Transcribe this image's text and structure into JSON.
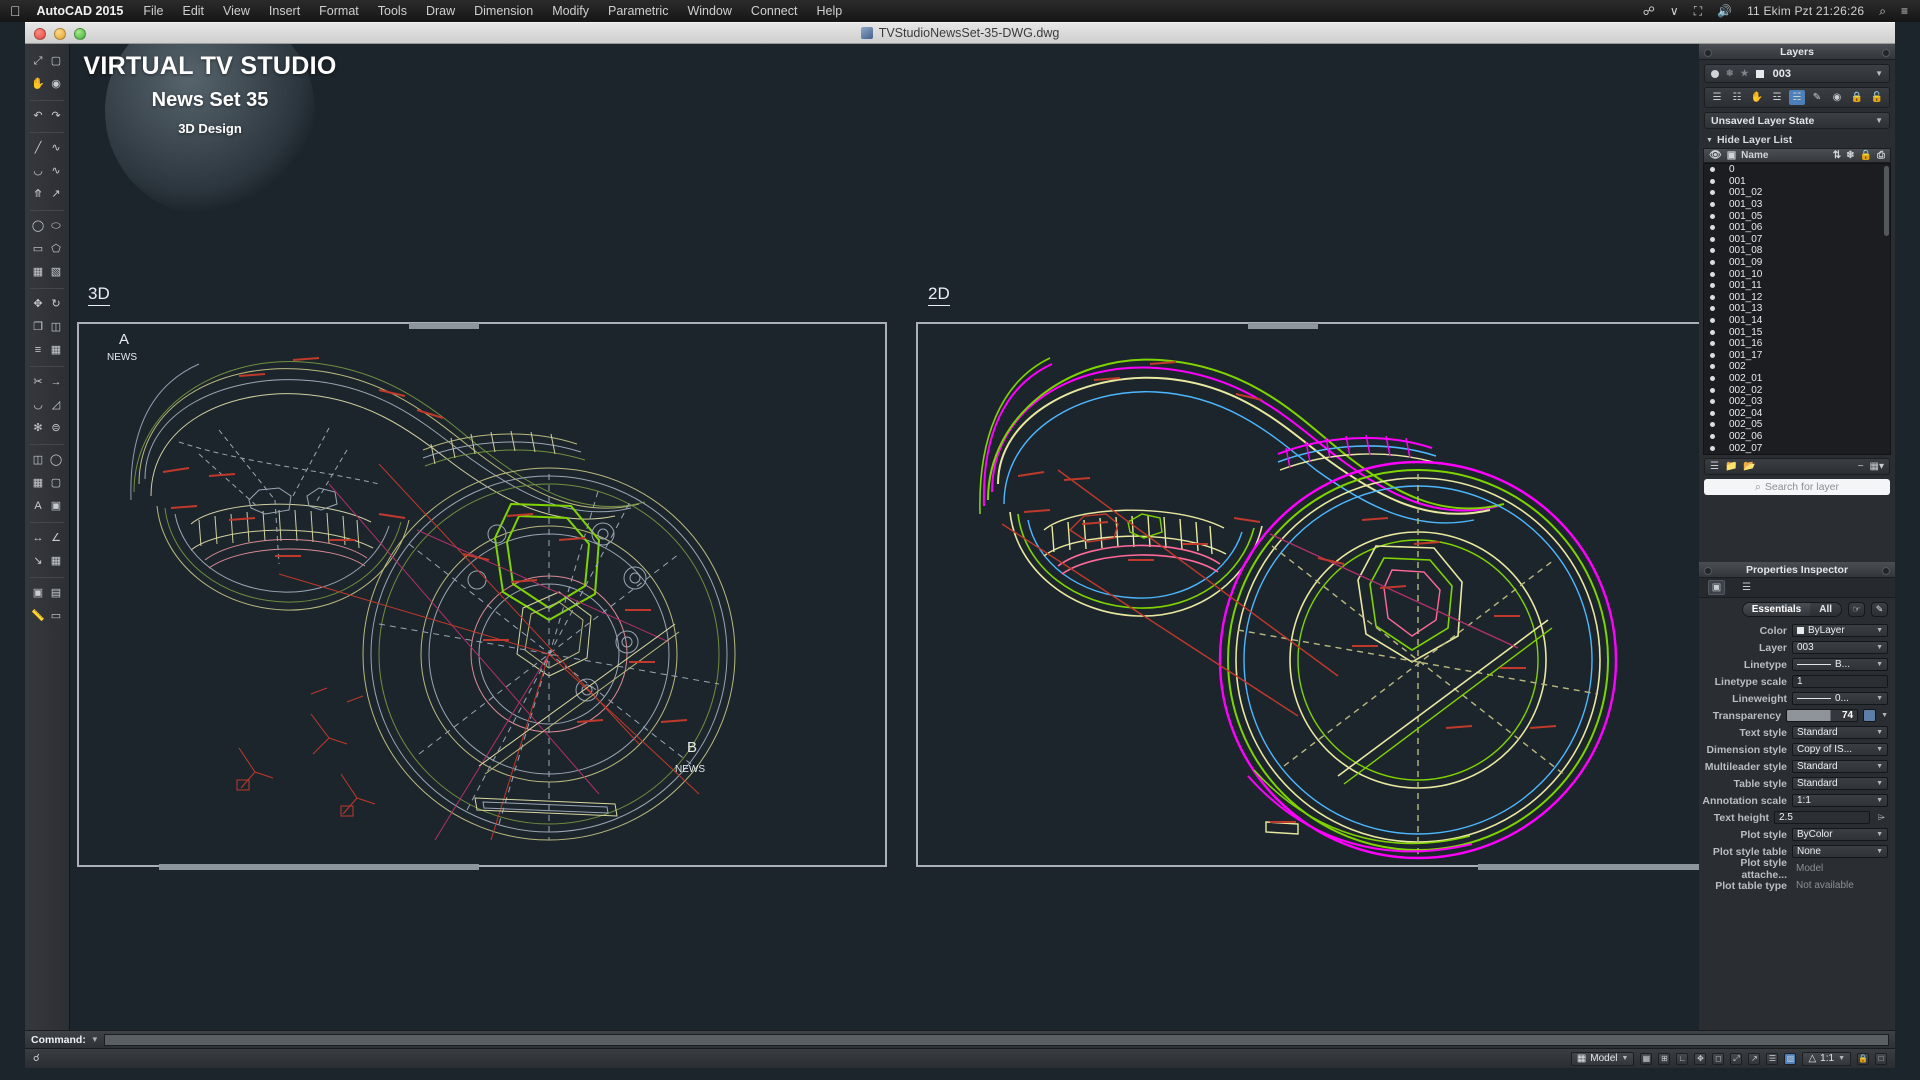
{
  "os_menu": {
    "apple_icon": "apple-icon",
    "app_name": "AutoCAD 2015",
    "items": [
      "File",
      "Edit",
      "View",
      "Insert",
      "Format",
      "Tools",
      "Draw",
      "Dimension",
      "Modify",
      "Parametric",
      "Window",
      "Connect",
      "Help"
    ],
    "status_icons": [
      "bluetooth-icon",
      "chevron-icon",
      "airplay-icon",
      "volume-icon"
    ],
    "clock": "11 Ekim Pzt 21:26:26",
    "search_icon": "search-icon",
    "notifications_icon": "list-icon"
  },
  "window": {
    "title": "TVStudioNewsSet-35-DWG.dwg",
    "file_icon": "dwg-file-icon",
    "close_icon": "close-icon",
    "minimize_icon": "minimize-icon",
    "zoom_icon": "zoom-icon"
  },
  "watermark": {
    "line1": "VIRTUAL TV STUDIO",
    "line2": "News Set 35",
    "line3": "3D Design"
  },
  "viewports": [
    {
      "label": "3D",
      "corner_top": "A",
      "corner_top_sub": "NEWS",
      "corner_bot": "B",
      "corner_bot_sub": "NEWS"
    },
    {
      "label": "2D"
    }
  ],
  "layers_panel": {
    "title": "Layers",
    "current_layer": "003",
    "state_selector": "Unsaved Layer State",
    "hide_list_label": "Hide Layer List",
    "column_name": "Name",
    "column_icons": [
      "visibility-icon",
      "filter-icon",
      "sort-icon",
      "freeze-icon",
      "lock-icon",
      "plot-icon"
    ],
    "toolbar_icons": [
      "new-layer-icon",
      "new-layer-vp-icon",
      "delete-layer-icon",
      "set-current-icon",
      "layer-properties-icon",
      "layer-walk-icon",
      "layer-isolate-icon",
      "layer-lock-icon",
      "layer-unlock-icon"
    ],
    "footer_icons": [
      "layer-states-icon",
      "new-group-filter-icon",
      "new-property-filter-icon"
    ],
    "footer_collapse": "minus-icon",
    "footer_view": "columns-icon",
    "search_placeholder": "Search for layer",
    "search_icon": "search-icon",
    "layers": [
      "0",
      "001",
      "001_02",
      "001_03",
      "001_05",
      "001_06",
      "001_07",
      "001_08",
      "001_09",
      "001_10",
      "001_11",
      "001_12",
      "001_13",
      "001_14",
      "001_15",
      "001_16",
      "001_17",
      "002",
      "002_01",
      "002_02",
      "002_03",
      "002_04",
      "002_05",
      "002_06",
      "002_07"
    ]
  },
  "properties_panel": {
    "title": "Properties Inspector",
    "tab_icons": [
      "object-properties-icon",
      "layers-stack-icon"
    ],
    "segments": [
      "Essentials",
      "All"
    ],
    "active_segment": "Essentials",
    "action_icons": [
      "quick-select-icon",
      "pickadd-icon"
    ],
    "rows": [
      {
        "label": "Color",
        "value": "ByLayer",
        "kind": "color"
      },
      {
        "label": "Layer",
        "value": "003",
        "kind": "select"
      },
      {
        "label": "Linetype",
        "value": "B...",
        "kind": "linetype"
      },
      {
        "label": "Linetype scale",
        "value": "1",
        "kind": "text"
      },
      {
        "label": "Lineweight",
        "value": "0...",
        "kind": "linetype"
      },
      {
        "label": "Transparency",
        "value": "74",
        "kind": "transparency"
      },
      {
        "label": "Text style",
        "value": "Standard",
        "kind": "select"
      },
      {
        "label": "Dimension style",
        "value": "Copy of IS...",
        "kind": "select"
      },
      {
        "label": "Multileader style",
        "value": "Standard",
        "kind": "select"
      },
      {
        "label": "Table style",
        "value": "Standard",
        "kind": "select"
      },
      {
        "label": "Annotation scale",
        "value": "1:1",
        "kind": "select"
      },
      {
        "label": "Text height",
        "value": "2.5",
        "kind": "stepper"
      },
      {
        "label": "Plot style",
        "value": "ByColor",
        "kind": "select"
      },
      {
        "label": "Plot style table",
        "value": "None",
        "kind": "select"
      },
      {
        "label": "Plot style attache...",
        "value": "Model",
        "kind": "readonly"
      },
      {
        "label": "Plot table type",
        "value": "Not available",
        "kind": "readonly"
      }
    ]
  },
  "command_line": {
    "label": "Command:",
    "value": "",
    "dropdown_icon": "chevron-down-icon"
  },
  "status_bar": {
    "model_label": "Model",
    "scale_label": "1:1",
    "lock_icon": "lock-icon",
    "grid_icon": "grid-icon",
    "snap_icon": "snap-icon",
    "ortho_icon": "ortho-icon",
    "polar_icon": "polar-icon",
    "osnap_icon": "osnap-icon",
    "otrack_icon": "otrack-icon",
    "dyn_icon": "dynamic-input-icon",
    "lw_icon": "lineweight-icon",
    "transparency_icon": "transparency-icon",
    "annotation_icon": "annotation-icon",
    "workspace_icon": "workspace-icon",
    "clean_icon": "clean-screen-icon",
    "scale_caret": "chevron-down-icon"
  },
  "colors": {
    "canvas_bg": "#1d252c",
    "panel_bg": "#2a2d31",
    "accent_blue": "#4d7fb8",
    "red_marks": "#c0392b",
    "magenta": "#ff00ff",
    "green": "#7fd400",
    "yellow": "#d8d86a"
  }
}
